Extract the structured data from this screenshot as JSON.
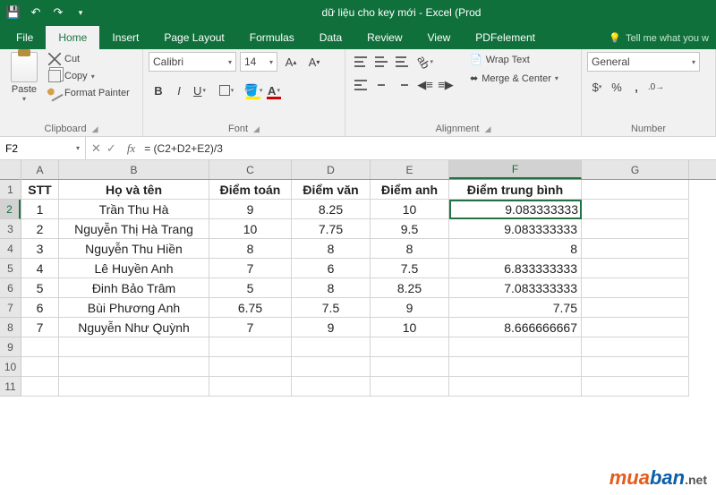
{
  "title": "dữ liệu cho key mới - Excel (Prod",
  "tabs": {
    "file": "File",
    "home": "Home",
    "insert": "Insert",
    "page": "Page Layout",
    "formulas": "Formulas",
    "data": "Data",
    "review": "Review",
    "view": "View",
    "pdf": "PDFelement"
  },
  "tell": "Tell me what you w",
  "clipboard": {
    "paste": "Paste",
    "cut": "Cut",
    "copy": "Copy",
    "fp": "Format Painter",
    "label": "Clipboard"
  },
  "font": {
    "name": "Calibri",
    "size": "14",
    "label": "Font"
  },
  "align": {
    "wrap": "Wrap Text",
    "merge": "Merge & Center",
    "label": "Alignment"
  },
  "number": {
    "fmt": "General",
    "label": "Number"
  },
  "namebox": "F2",
  "formula": "= (C2+D2+E2)/3",
  "colhdrs": [
    "A",
    "B",
    "C",
    "D",
    "E",
    "F",
    "G"
  ],
  "rownums": [
    "1",
    "2",
    "3",
    "4",
    "5",
    "6",
    "7",
    "8",
    "9",
    "10",
    "11"
  ],
  "headers": {
    "a": "STT",
    "b": "Họ và tên",
    "c": "Điểm toán",
    "d": "Điểm văn",
    "e": "Điểm anh",
    "f": "Điểm trung bình"
  },
  "rows": [
    {
      "a": "1",
      "b": "Trần Thu Hà",
      "c": "9",
      "d": "8.25",
      "e": "10",
      "f": "9.083333333"
    },
    {
      "a": "2",
      "b": "Nguyễn Thị Hà Trang",
      "c": "10",
      "d": "7.75",
      "e": "9.5",
      "f": "9.083333333"
    },
    {
      "a": "3",
      "b": "Nguyễn Thu Hiền",
      "c": "8",
      "d": "8",
      "e": "8",
      "f": "8"
    },
    {
      "a": "4",
      "b": "Lê Huyền Anh",
      "c": "7",
      "d": "6",
      "e": "7.5",
      "f": "6.833333333"
    },
    {
      "a": "5",
      "b": "Đinh Bảo Trâm",
      "c": "5",
      "d": "8",
      "e": "8.25",
      "f": "7.083333333"
    },
    {
      "a": "6",
      "b": "Bùi Phương Anh",
      "c": "6.75",
      "d": "7.5",
      "e": "9",
      "f": "7.75"
    },
    {
      "a": "7",
      "b": "Nguyễn Như Quỳnh",
      "c": "7",
      "d": "9",
      "e": "10",
      "f": "8.666666667"
    }
  ],
  "wm": {
    "m": "mua",
    "b": "ban",
    "n": ".net"
  }
}
